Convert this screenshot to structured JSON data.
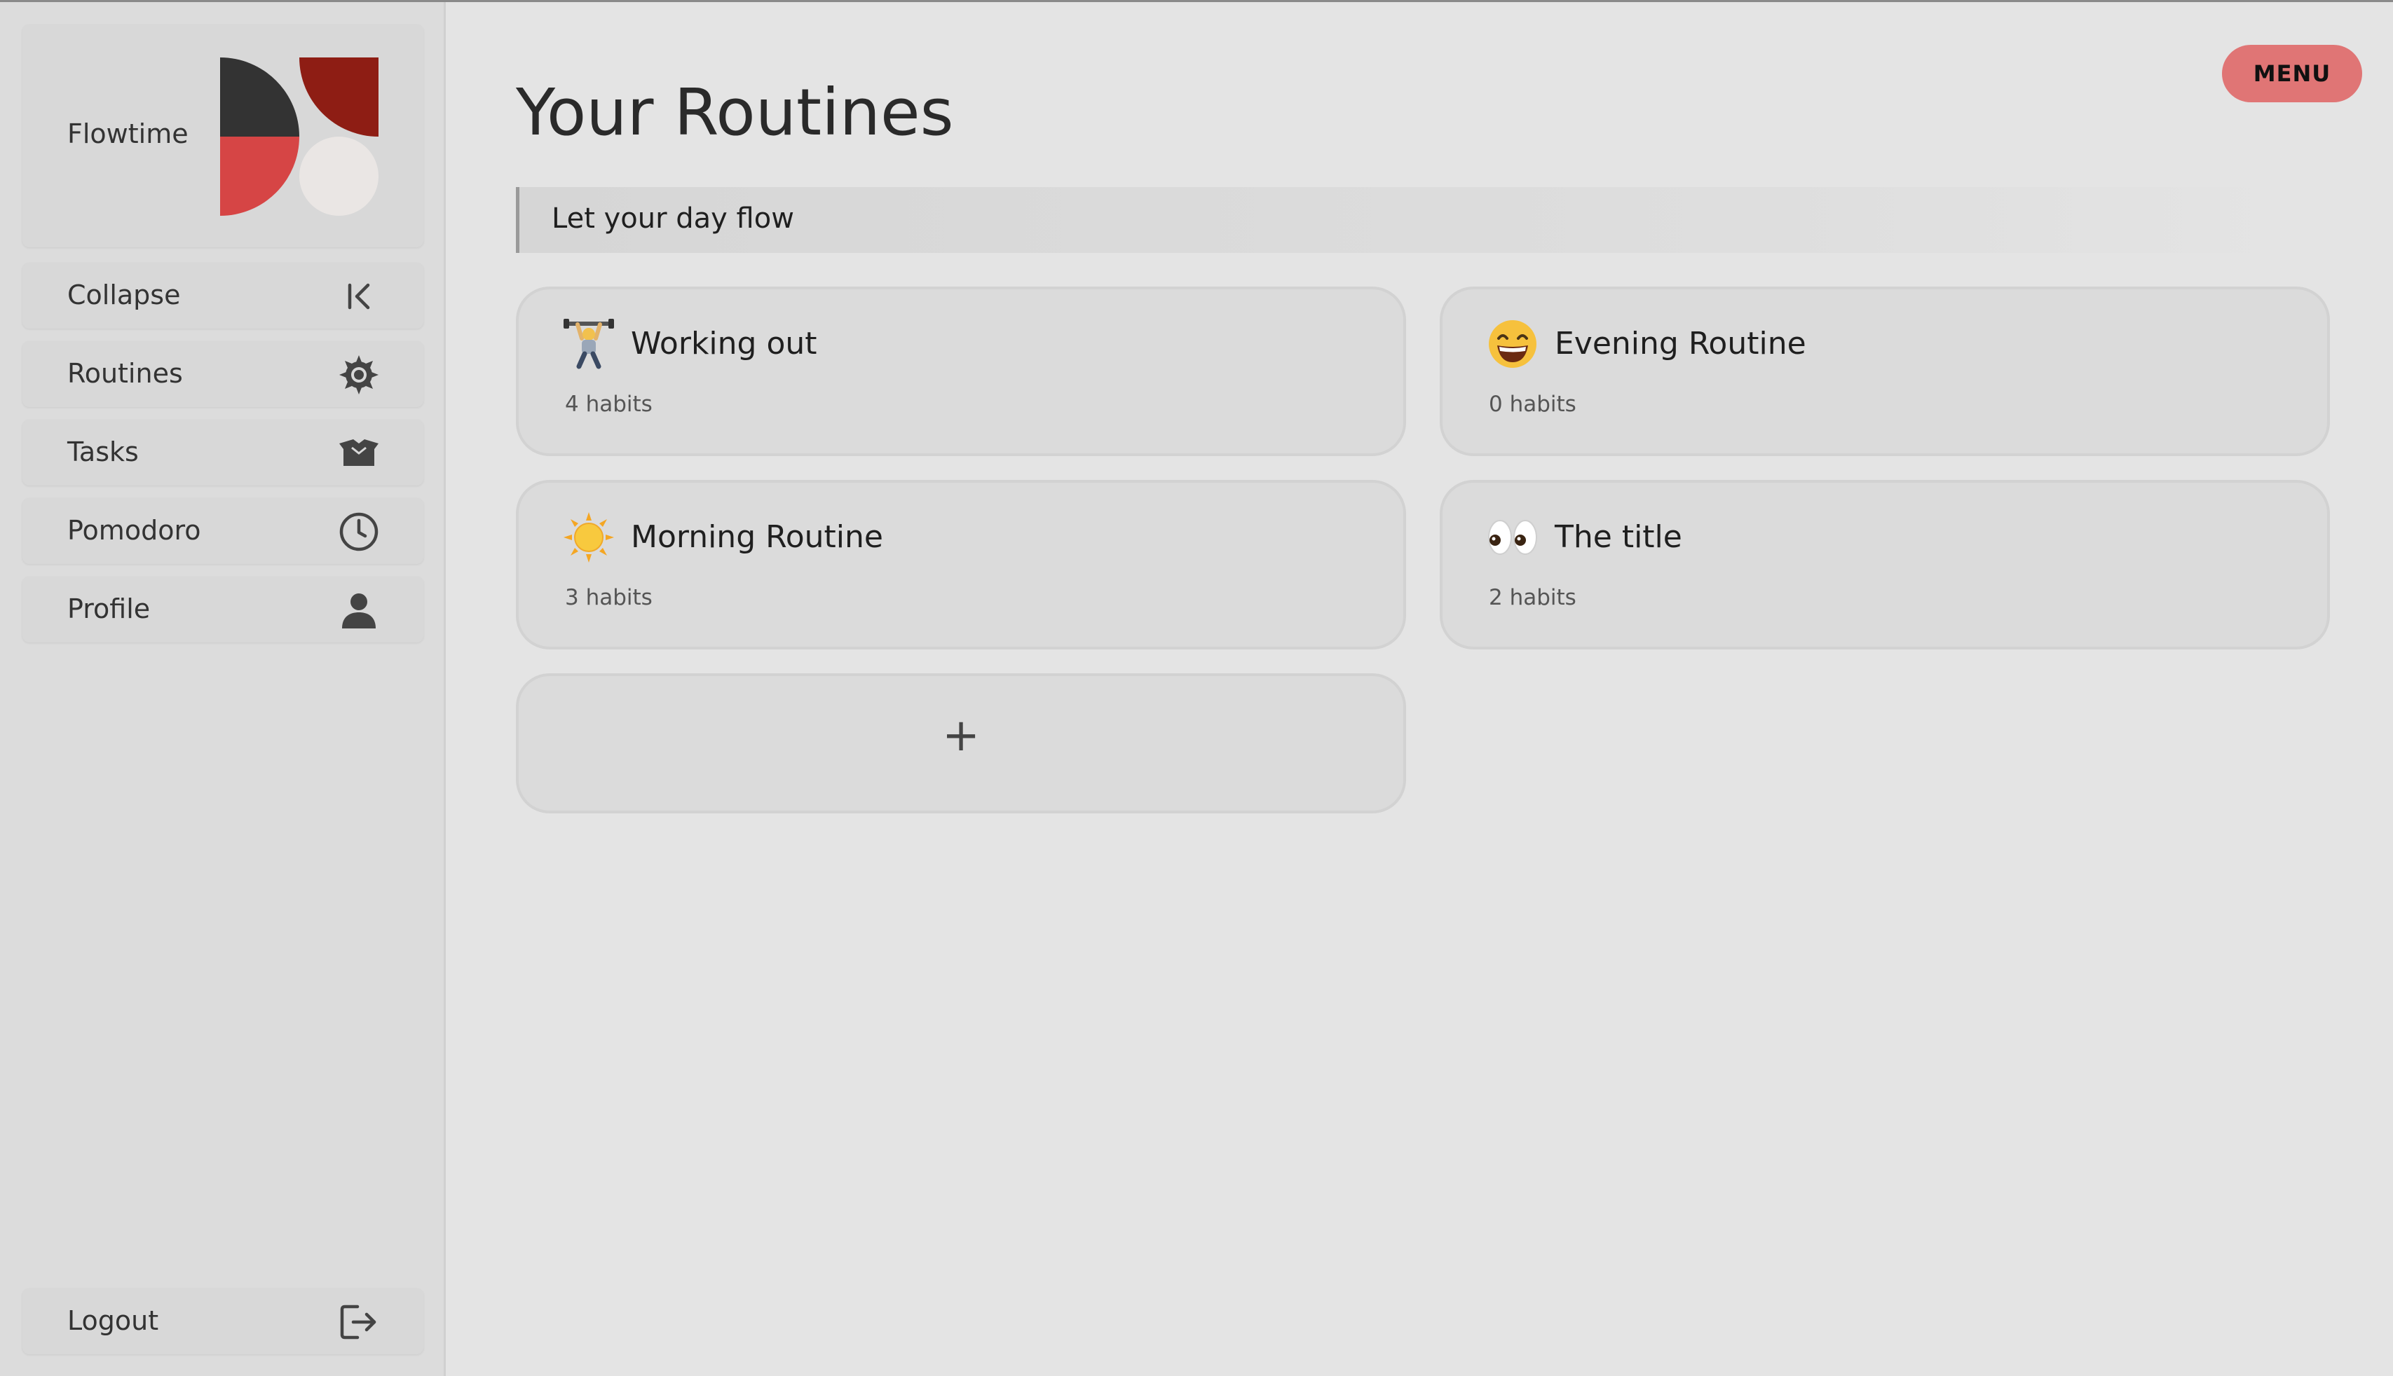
{
  "brand": {
    "name": "Flowtime"
  },
  "sidebar": {
    "items": [
      {
        "label": "Collapse",
        "icon": "collapse-icon"
      },
      {
        "label": "Routines",
        "icon": "gear-icon"
      },
      {
        "label": "Tasks",
        "icon": "box-icon"
      },
      {
        "label": "Pomodoro",
        "icon": "clock-icon"
      },
      {
        "label": "Profile",
        "icon": "user-icon"
      }
    ],
    "logout": {
      "label": "Logout",
      "icon": "logout-icon"
    }
  },
  "header": {
    "menu_label": "MENU"
  },
  "main": {
    "title": "Your Routines",
    "tagline": "Let your day flow",
    "routines": [
      {
        "title": "Working out",
        "habits": "4 habits",
        "emoji": "weightlifter-emoji"
      },
      {
        "title": "Evening Routine",
        "habits": "0 habits",
        "emoji": "grinning-face-emoji"
      },
      {
        "title": "Morning Routine",
        "habits": "3 habits",
        "emoji": "sun-emoji"
      },
      {
        "title": "The title",
        "habits": "2 habits",
        "emoji": "eyes-emoji"
      }
    ],
    "add_label": "+"
  },
  "colors": {
    "accent": "#e07575",
    "logo_dark": "#333333",
    "logo_red": "#d64545",
    "logo_darkred": "#8e1d14",
    "logo_light": "#eae6e4"
  }
}
